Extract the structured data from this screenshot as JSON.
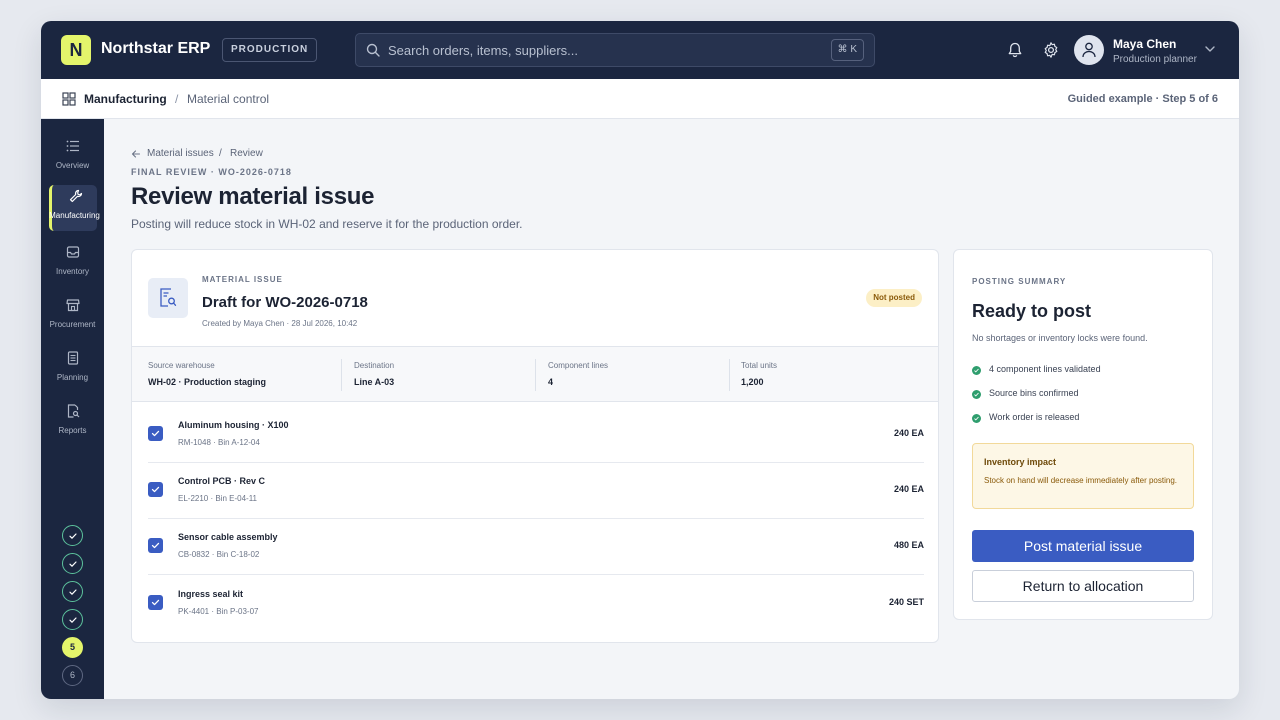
{
  "app": {
    "logo_letter": "N",
    "name": "Northstar ERP",
    "environment": "PRODUCTION"
  },
  "search": {
    "placeholder": "Search orders, items, suppliers...",
    "shortcut": "⌘ K"
  },
  "topbar_icons": [
    "bell-icon",
    "gear-icon",
    "user-icon",
    "chevron-down-icon"
  ],
  "user": {
    "name": "Maya Chen",
    "role": "Production planner"
  },
  "breadcrumb_bar": {
    "module": "Manufacturing",
    "separator": "/",
    "page": "Material control",
    "guide": "Guided example · Step 5 of 6"
  },
  "nav": {
    "items": [
      {
        "label": "Overview",
        "icon": "list-icon"
      },
      {
        "label": "Manufacturing",
        "icon": "wrench-icon",
        "active": true
      },
      {
        "label": "Inventory",
        "icon": "inbox-icon"
      },
      {
        "label": "Procurement",
        "icon": "store-icon"
      },
      {
        "label": "Planning",
        "icon": "document-icon"
      },
      {
        "label": "Reports",
        "icon": "report-search-icon"
      }
    ]
  },
  "steps": {
    "total": 6,
    "current": 5,
    "labels": [
      "5",
      "6"
    ]
  },
  "page": {
    "breadcrumb": [
      "Material issues",
      "/",
      "Review"
    ],
    "eyebrow": "FINAL REVIEW · WO-2026-0718",
    "title": "Review material issue",
    "subtitle": "Posting will reduce stock in WH-02 and reserve it for the production order."
  },
  "issue": {
    "eyebrow": "MATERIAL ISSUE",
    "title": "Draft for WO-2026-0718",
    "meta": "Created by Maya Chen · 28 Jul 2026, 10:42",
    "status": "Not posted",
    "stats": [
      {
        "label": "Source warehouse",
        "value": "WH-02 · Production staging"
      },
      {
        "label": "Destination",
        "value": "Line A-03"
      },
      {
        "label": "Component lines",
        "value": "4"
      },
      {
        "label": "Total units",
        "value": "1,200"
      }
    ],
    "lines": [
      {
        "name": "Aluminum housing · X100",
        "meta": "RM-1048 · Bin A-12-04",
        "qty": "240 EA",
        "checked": true
      },
      {
        "name": "Control PCB · Rev C",
        "meta": "EL-2210 · Bin E-04-11",
        "qty": "240 EA",
        "checked": true
      },
      {
        "name": "Sensor cable assembly",
        "meta": "CB-0832 · Bin C-18-02",
        "qty": "480 EA",
        "checked": true
      },
      {
        "name": "Ingress seal kit",
        "meta": "PK-4401 · Bin P-03-07",
        "qty": "240 SET",
        "checked": true
      }
    ]
  },
  "summary": {
    "eyebrow": "POSTING SUMMARY",
    "title": "Ready to post",
    "subtitle": "No shortages or inventory locks were found.",
    "checks": [
      "4 component lines validated",
      "Source bins confirmed",
      "Work order is released"
    ],
    "impact_title": "Inventory impact",
    "impact_body": "Stock on hand will decrease immediately after posting.",
    "primary_action": "Post material issue",
    "secondary_action": "Return to allocation"
  },
  "colors": {
    "topbar": "#1b2640",
    "accent": "#e4f56b",
    "primary": "#3a5cc2",
    "success": "#2f9e6e",
    "warning_bg": "#fdf7e6"
  }
}
